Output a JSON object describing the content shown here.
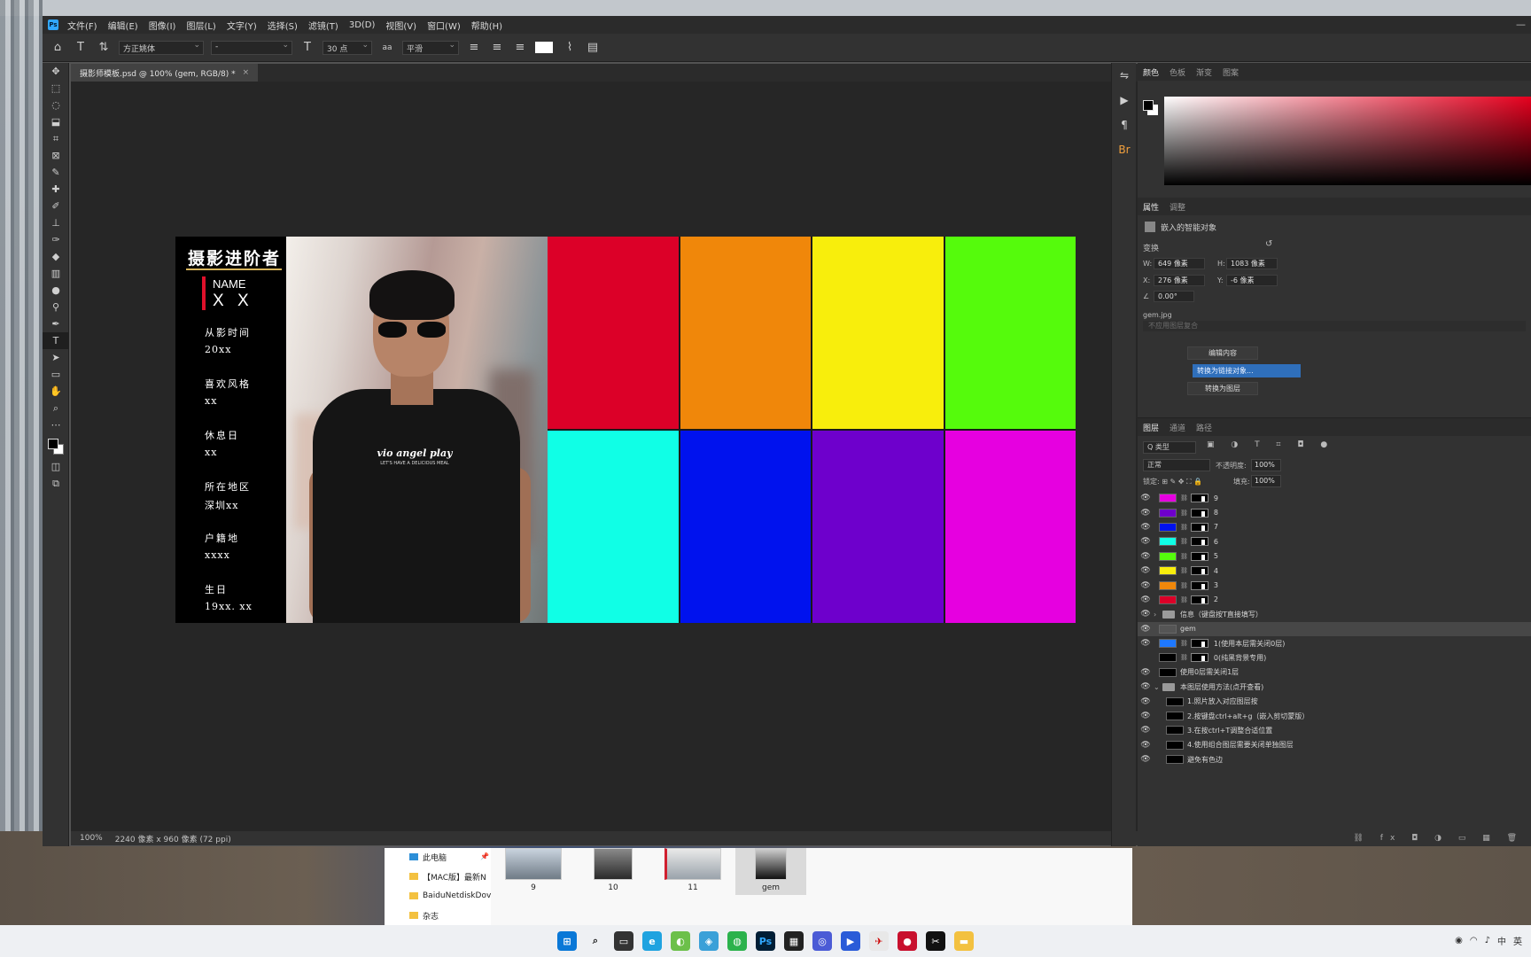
{
  "menubar": {
    "items": [
      "文件(F)",
      "编辑(E)",
      "图像(I)",
      "图层(L)",
      "文字(Y)",
      "选择(S)",
      "滤镜(T)",
      "3D(D)",
      "视图(V)",
      "窗口(W)",
      "帮助(H)"
    ],
    "window_controls": "—"
  },
  "options": {
    "font_family": "方正姚体",
    "font_style": "-",
    "font_size": "30 点",
    "aa_label": "aa",
    "antialias": "平滑"
  },
  "document": {
    "tab_title": "摄影师模板.psd @ 100% (gem, RGB/8) *",
    "close": "×",
    "status_zoom": "100%",
    "status_info": "2240 像素 x 960 像素 (72 ppi)"
  },
  "template": {
    "title": "摄影进阶者",
    "name_label": "NAME",
    "name_value": "X X",
    "fields": [
      {
        "label": "从影时间",
        "value": "20xx"
      },
      {
        "label": "喜欢风格",
        "value": "xx"
      },
      {
        "label": "休息日",
        "value": "xx"
      },
      {
        "label": "所在地区",
        "value": "深圳xx"
      },
      {
        "label": "户籍地",
        "value": "xxxx"
      },
      {
        "label": "生日",
        "value": "19xx. xx"
      }
    ],
    "shirt_text": "vio angel play",
    "shirt_subtext": "LET'S HAVE A DELICIOUS MEAL",
    "grid_colors": [
      "#dc0028",
      "#f0870a",
      "#f8ee0c",
      "#55fb0c",
      "#10ffe6",
      "#0012ee",
      "#6e00cc",
      "#e600e0"
    ]
  },
  "color_panel": {
    "tabs": [
      "颜色",
      "色板",
      "渐变",
      "图案"
    ],
    "hue": "#e6001e"
  },
  "properties": {
    "tabs": [
      "属性",
      "调整"
    ],
    "object_type": "嵌入的智能对象",
    "transform_label": "变换",
    "w_label": "W:",
    "w_value": "649 像素",
    "h_label": "H:",
    "h_value": "1083 像素",
    "x_label": "X:",
    "x_value": "276 像素",
    "y_label": "Y:",
    "y_value": "-6 像素",
    "angle_value": "0.00°",
    "filename": "gem.jpg",
    "comp_placeholder": "不应用图层复合",
    "buttons": {
      "edit": "编辑内容",
      "convert_linked": "转换为链接对象...",
      "convert_layer": "转换为图层"
    }
  },
  "layers": {
    "tabs": [
      "图层",
      "通道",
      "路径"
    ],
    "filter": "Q 类型",
    "filter_icons": "▣ ◑ T ⌗ ◘ ●",
    "blend_mode": "正常",
    "opacity_label": "不透明度:",
    "opacity": "100%",
    "lock_label": "锁定: ⊞ ✎ ✥ ⛶ 🔒",
    "fill_label": "填充:",
    "fill": "100%",
    "items": [
      {
        "name": "9",
        "visible": true,
        "thumb": "#e600e0",
        "mask": true
      },
      {
        "name": "8",
        "visible": true,
        "thumb": "#6e00cc",
        "mask": true
      },
      {
        "name": "7",
        "visible": true,
        "thumb": "#0012ee",
        "mask": true
      },
      {
        "name": "6",
        "visible": true,
        "thumb": "#10ffe6",
        "mask": true
      },
      {
        "name": "5",
        "visible": true,
        "thumb": "#55fb0c",
        "mask": true
      },
      {
        "name": "4",
        "visible": true,
        "thumb": "#f8ee0c",
        "mask": true
      },
      {
        "name": "3",
        "visible": true,
        "thumb": "#f0870a",
        "mask": true
      },
      {
        "name": "2",
        "visible": true,
        "thumb": "#dc0028",
        "mask": true
      },
      {
        "name": "信息（键盘按T直接填写）",
        "visible": true,
        "folder": true,
        "collapsed": true
      },
      {
        "name": "gem",
        "visible": true,
        "thumb": "#555555",
        "smart": true,
        "selected": true
      },
      {
        "name": "1(使用本层需关闭0层)",
        "visible": true,
        "thumb": "#1e78ff",
        "mask": true
      },
      {
        "name": "0(纯黑背景专用)",
        "visible": false,
        "thumb": "#000000",
        "mask": true
      },
      {
        "name": "使用0层需关闭1层",
        "visible": true,
        "thumb": "#000000"
      },
      {
        "name": "本图层使用方法(点开查看)",
        "visible": true,
        "folder": true,
        "expanded": true
      },
      {
        "name": "1.照片放入对应图层按",
        "visible": true,
        "thumb": "#000000",
        "child": true
      },
      {
        "name": "2.按键盘ctrl+alt+g（嵌入剪切蒙版）",
        "visible": true,
        "thumb": "#000000",
        "child": true
      },
      {
        "name": "3.在按ctrl+T调整合适位置",
        "visible": true,
        "thumb": "#000000",
        "child": true
      },
      {
        "name": "4.使用组合图层需要关闭单独图层",
        "visible": true,
        "thumb": "#000000",
        "child": true
      },
      {
        "name": "避免有色边",
        "visible": true,
        "thumb": "#000000",
        "child": true
      }
    ],
    "footer": "⛓ fx ◘ ◑ ▭ ▦ 🗑"
  },
  "explorer": {
    "nav": [
      "此电脑",
      "【MAC版】最新N",
      "BaiduNetdiskDov",
      "杂志"
    ],
    "files": [
      "9",
      "10",
      "11",
      "gem"
    ]
  },
  "taskbar": {
    "tray_lang": "中",
    "tray_extra": "英"
  }
}
